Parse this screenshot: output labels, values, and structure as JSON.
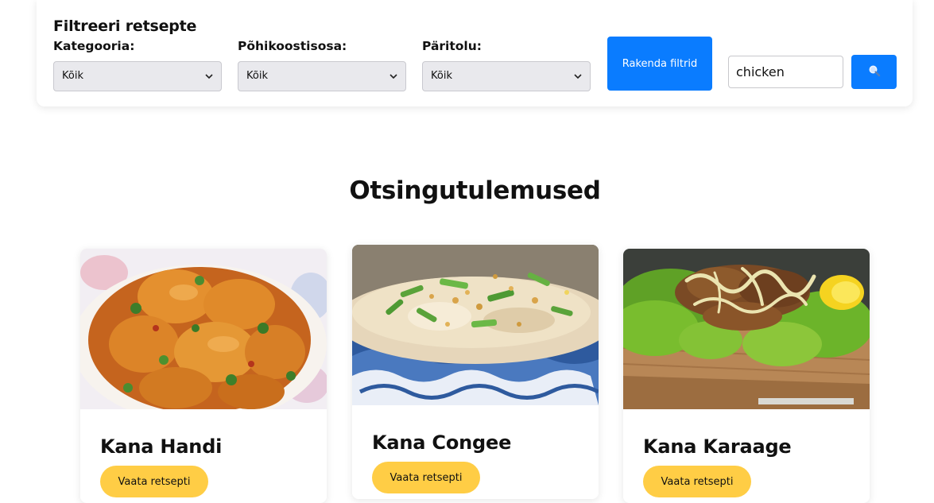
{
  "filters": {
    "title": "Filtreeri retsepte",
    "category": {
      "label": "Kategooria:",
      "selected": "Kõik"
    },
    "ingredient": {
      "label": "Põhikoostisosa:",
      "selected": "Kõik"
    },
    "origin": {
      "label": "Päritolu:",
      "selected": "Kõik"
    },
    "apply_label": "Rakenda filtrid",
    "search_value": "chicken",
    "search_icon": "magnifier-icon"
  },
  "results": {
    "heading": "Otsingutulemused",
    "cards": [
      {
        "title": "Kana Handi",
        "button": "Vaata retsepti",
        "image": "chicken-curry-photo"
      },
      {
        "title": "Kana Congee",
        "button": "Vaata retsepti",
        "image": "rice-porridge-photo"
      },
      {
        "title": "Kana Karaage",
        "button": "Vaata retsepti",
        "image": "fried-chicken-salad-photo"
      }
    ]
  },
  "colors": {
    "primary": "#0a7cff",
    "accent": "#ffcd45"
  }
}
